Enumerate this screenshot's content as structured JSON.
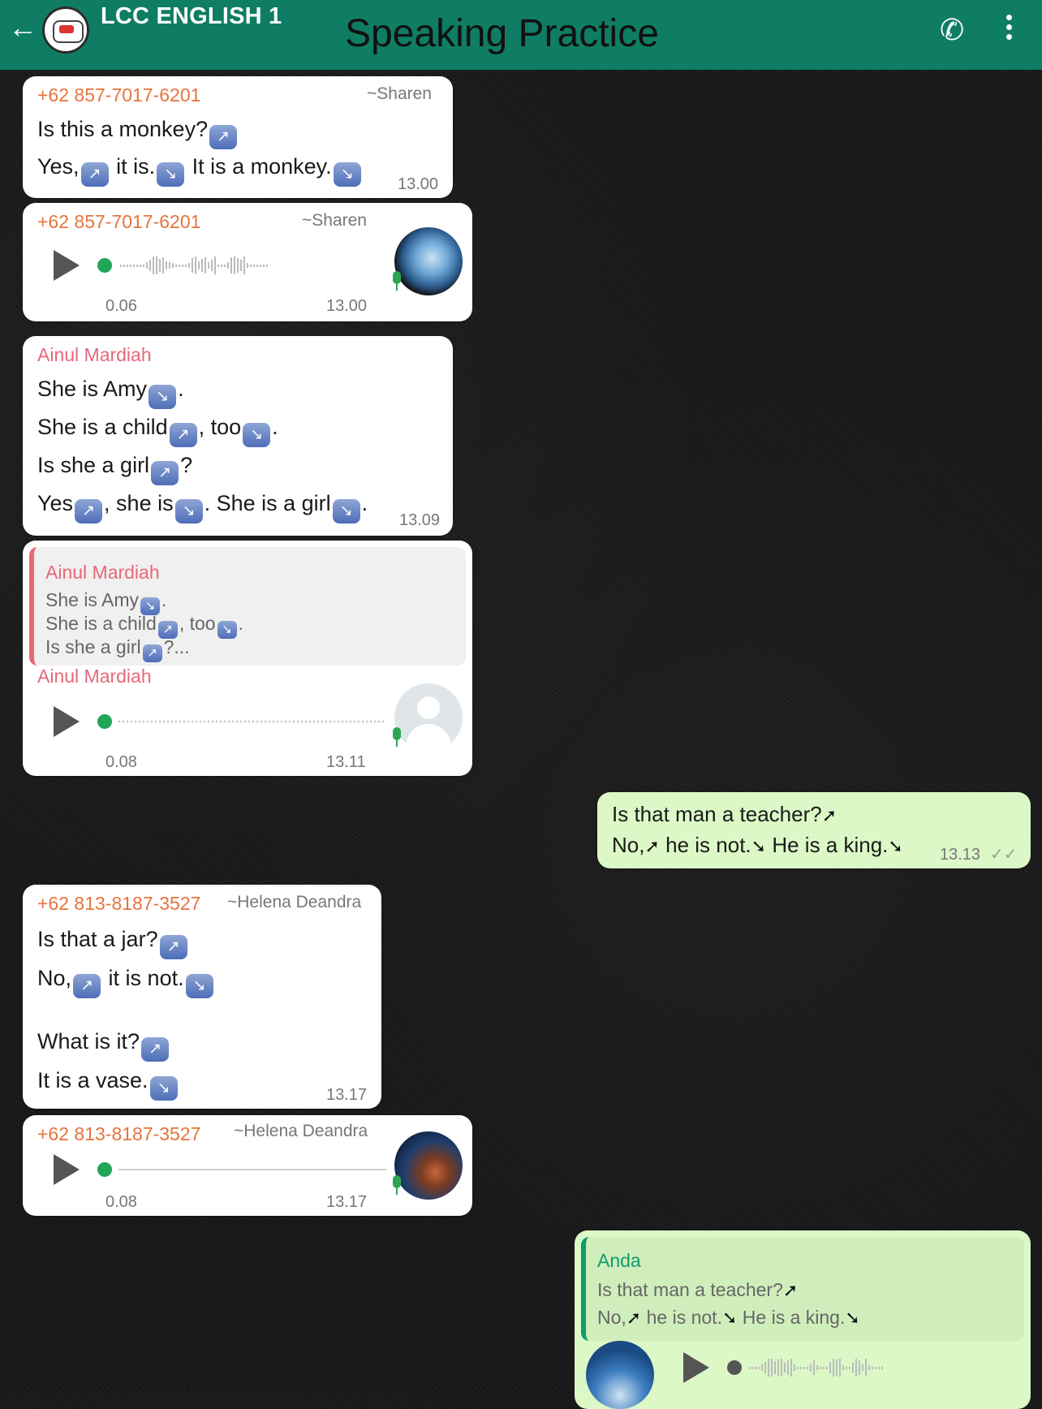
{
  "header": {
    "group_name": "LCC ENGLISH 1",
    "title": "Speaking Practice",
    "back_icon": "arrow-left-icon",
    "call_icon": "add-call-icon",
    "more_icon": "more-vert-icon",
    "colors": {
      "bar": "#0f7d63",
      "title": "#111111"
    }
  },
  "messages": [
    {
      "sender": "+62 857-7017-6201",
      "alias": "~Sharen",
      "line1": "Is this a monkey?",
      "line2a": "Yes,",
      "line2b": "it is.",
      "line2c": "It is a monkey.",
      "time": "13.00"
    },
    {
      "sender": "+62 857-7017-6201",
      "alias": "~Sharen",
      "duration": "0.06",
      "time": "13.00"
    },
    {
      "sender": "Ainul Mardiah",
      "l1a": "She is Amy",
      "l1b": ".",
      "l2a": "She is a child",
      "l2b": ", too",
      "l2c": ".",
      "l3a": "Is she a girl",
      "l3b": "?",
      "l4a": "Yes",
      "l4b": ", she is",
      "l4c": ". She is a girl",
      "l4d": ".",
      "time": "13.09"
    },
    {
      "quote_sender": "Ainul Mardiah",
      "q1a": "She is Amy",
      "q1b": ".",
      "q2a": "She is a child",
      "q2b": ", too",
      "q2c": ".",
      "q3a": "Is she a girl",
      "q3b": "?...",
      "sender": "Ainul Mardiah",
      "duration": "0.08",
      "time": "13.11"
    },
    {
      "outgoing": true,
      "line1": "Is that man a teacher?",
      "line2a": "No,",
      "line2b": "he is not.",
      "line2c": "He is a king.",
      "time": "13.13",
      "status_icon": "double-check-icon"
    },
    {
      "sender": "+62 813-8187-3527",
      "alias": "~Helena Deandra",
      "l1": "Is that a jar?",
      "l2a": "No,",
      "l2b": "it is not.",
      "l3": "What is it?",
      "l4": "It is a vase.",
      "time": "13.17"
    },
    {
      "sender": "+62 813-8187-3527",
      "alias": "~Helena Deandra",
      "duration": "0.08",
      "time": "13.17"
    },
    {
      "outgoing": true,
      "quote_sender": "Anda",
      "q1": "Is that man a teacher?",
      "q2a": "No,",
      "q2b": "he is not.",
      "q2c": "He is a king."
    }
  ],
  "colors": {
    "incoming_bubble": "#ffffff",
    "outgoing_bubble": "#dcf8c6",
    "sender_name": "#e8677a",
    "sender_number": "#e6733d",
    "voice_dot": "#22a556"
  }
}
